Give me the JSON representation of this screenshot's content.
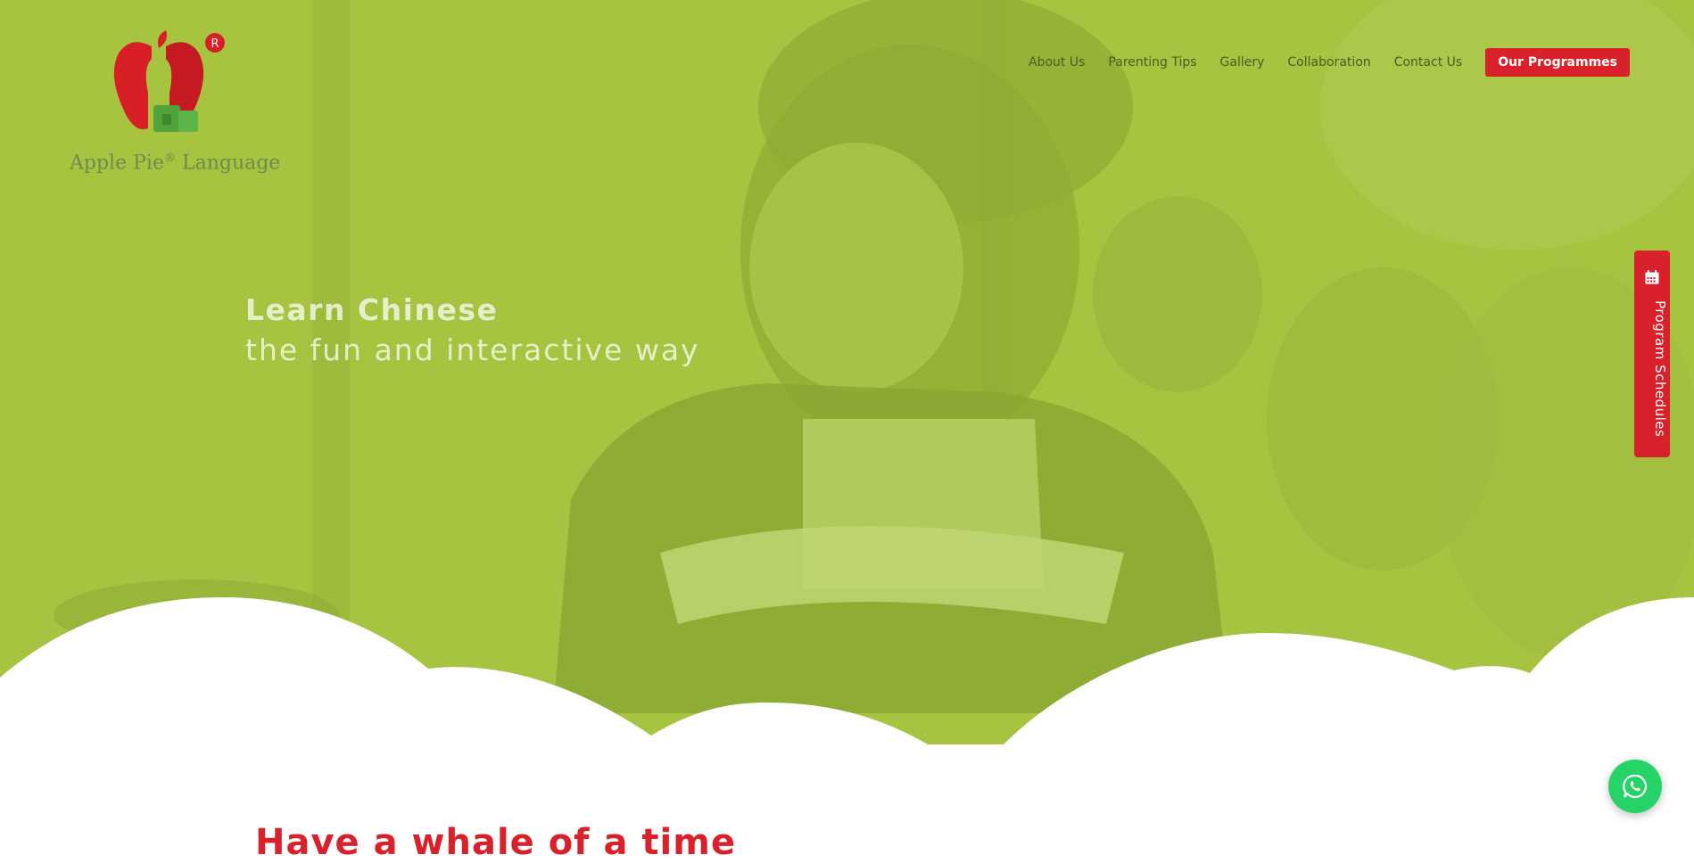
{
  "brand": {
    "logo_text": "Apple Pie",
    "logo_reg": "®",
    "logo_suffix": " Language"
  },
  "nav": {
    "links": [
      "About Us",
      "Parenting Tips",
      "Gallery",
      "Collaboration",
      "Contact Us"
    ],
    "cta": "Our Programmes"
  },
  "hero": {
    "line1": "Learn Chinese",
    "line2": "the fun and interactive way"
  },
  "side_tab": {
    "label": "Program Schedules",
    "icon": "calendar-icon"
  },
  "whatsapp": {
    "icon": "whatsapp-icon"
  },
  "section": {
    "title": "Have a whale of a time"
  },
  "colors": {
    "accent": "#d8212a",
    "hero_overlay": "#a6c440",
    "whatsapp": "#25d366"
  }
}
